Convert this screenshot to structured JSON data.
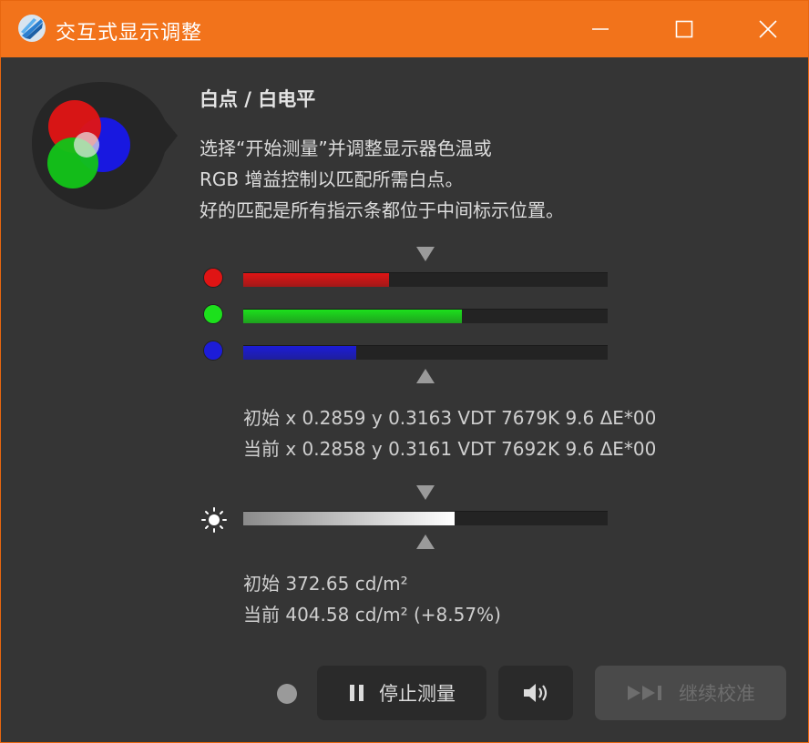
{
  "window": {
    "title": "交互式显示调整",
    "accent": "#f2731b"
  },
  "panel": {
    "heading": "白点 / 白电平",
    "description": [
      "选择“开始测量”并调整显示器色温或",
      "RGB 增益控制以匹配所需白点。",
      "好的匹配是所有指示条都位于中间标示位置。"
    ]
  },
  "rgb_bars": [
    {
      "channel": "red",
      "color": "#e01414",
      "level": 0.4
    },
    {
      "channel": "green",
      "color": "#1ce01c",
      "level": 0.6
    },
    {
      "channel": "blue",
      "color": "#1c1cd8",
      "level": 0.31
    }
  ],
  "whitepoint_readout": {
    "initial": "初始 x 0.2859 y 0.3163 VDT 7679K 9.6 ΔE*00",
    "current": "当前 x 0.2858 y 0.3161 VDT 7692K 9.6 ΔE*00"
  },
  "luminance": {
    "level": 0.58,
    "initial": "初始 372.65 cd/m²",
    "current": "当前 404.58 cd/m² (+8.57%)"
  },
  "controls": {
    "stop_label": "停止测量",
    "continue_label": "继续校准",
    "stop_icon": "pause-icon",
    "sound_icon": "speaker-icon",
    "continue_icon": "skip-forward-icon"
  }
}
